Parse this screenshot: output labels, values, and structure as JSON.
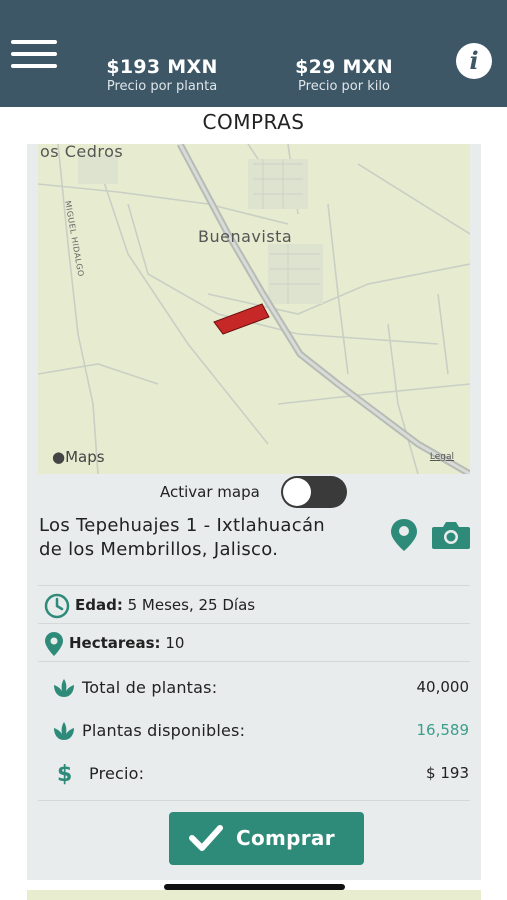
{
  "header": {
    "price_plant_value": "$193 MXN",
    "price_plant_label": "Precio por planta",
    "price_kilo_value": "$29 MXN",
    "price_kilo_label": "Precio por kilo",
    "info_glyph": "i"
  },
  "page_title": "COMPRAS",
  "map": {
    "town_top": "os Cedros",
    "town_main": "Buenavista",
    "road_label": "MIGUEL HIDALGO",
    "logo_text": "Maps",
    "legal_text": "Legal",
    "parcel_color": "#c62828"
  },
  "toggle": {
    "label": "Activar mapa",
    "on": false
  },
  "location": {
    "name": "Los Tepehuajes 1 - Ixtlahuacán de los Membrillos, Jalisco."
  },
  "details": {
    "age_label": "Edad:",
    "age_value": "5 Meses, 25 Días",
    "hectares_label": "Hectareas:",
    "hectares_value": "10"
  },
  "stats": [
    {
      "label": "Total de plantas:",
      "value": "40,000",
      "icon": "plant-icon"
    },
    {
      "label": "Plantas disponibles:",
      "value": "16,589",
      "icon": "plant-icon"
    },
    {
      "label": "Precio:",
      "value": "$ 193",
      "icon": "dollar-icon"
    }
  ],
  "buy_button": {
    "label": "Comprar"
  },
  "colors": {
    "header_bg": "#3d5766",
    "accent": "#2e8b7a",
    "card_bg": "#e8ecec"
  }
}
